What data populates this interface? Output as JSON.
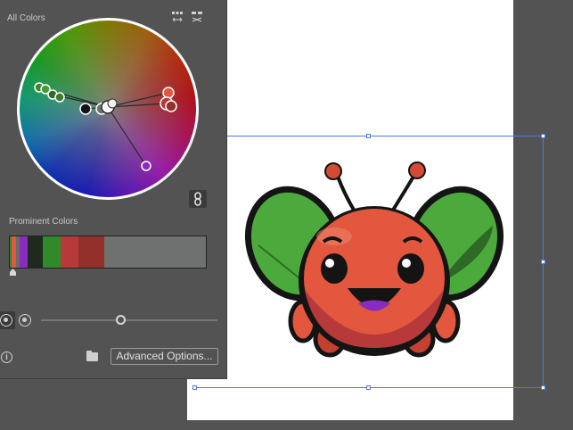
{
  "panel": {
    "all_colors_label": "All Colors",
    "prominent_colors_label": "Prominent Colors",
    "advanced_options_label": "Advanced Options...",
    "icons": {
      "link": "link-harmony-icon",
      "info": "info-icon",
      "folder": "folder-icon",
      "swap_1": "arrange-colors-icon",
      "swap_2": "swap-colors-icon"
    },
    "prominent_colors": [
      {
        "color": "#3a8a2a",
        "fraction": 0.01
      },
      {
        "color": "#e2573d",
        "fraction": 0.02
      },
      {
        "color": "#6b6b6b",
        "fraction": 0.02
      },
      {
        "color": "#8a2bc0",
        "fraction": 0.04
      },
      {
        "color": "#1e2a1e",
        "fraction": 0.08
      },
      {
        "color": "#2f8a2a",
        "fraction": 0.09
      },
      {
        "color": "#b8393a",
        "fraction": 0.09
      },
      {
        "color": "#93302c",
        "fraction": 0.13
      },
      {
        "color": "#6e716f",
        "fraction": 0.52
      }
    ],
    "brightness_level": 0.45
  },
  "artwork": {
    "description_icon": "bug-character-illustration",
    "colors": {
      "body": "#e2573d",
      "body_shadow": "#b8393a",
      "wing": "#4caa3c",
      "wing_dark": "#2e6a26",
      "outline": "#141414",
      "tongue": "#8a2bc0"
    }
  }
}
